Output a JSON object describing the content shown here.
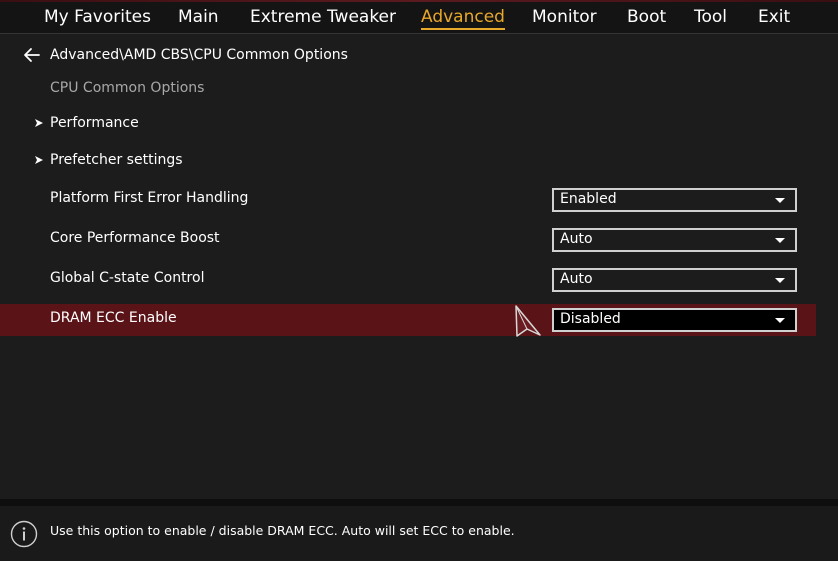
{
  "nav": {
    "tabs": [
      {
        "label": "My Favorites"
      },
      {
        "label": "Main"
      },
      {
        "label": "Extreme Tweaker"
      },
      {
        "label": "Advanced"
      },
      {
        "label": "Monitor"
      },
      {
        "label": "Boot"
      },
      {
        "label": "Tool"
      },
      {
        "label": "Exit"
      }
    ],
    "active_tab": "Advanced"
  },
  "breadcrumb": {
    "path": "Advanced\\AMD CBS\\CPU Common Options"
  },
  "section": {
    "title": "CPU Common Options"
  },
  "submenus": [
    {
      "label": "Performance"
    },
    {
      "label": "Prefetcher settings"
    }
  ],
  "options": [
    {
      "label": "Platform First Error Handling",
      "value": "Enabled"
    },
    {
      "label": "Core Performance Boost",
      "value": "Auto"
    },
    {
      "label": "Global C-state Control",
      "value": "Auto"
    },
    {
      "label": "DRAM ECC Enable",
      "value": "Disabled",
      "selected": true
    }
  ],
  "help": {
    "text": "Use this option to enable / disable DRAM ECC. Auto will set ECC to enable."
  },
  "colors": {
    "background": "#1c1c1c",
    "active_tab": "#e8a82a",
    "selected_row": "#5a1418"
  },
  "icons": [
    "back-arrow-icon",
    "chevron-right-icon",
    "dropdown-caret-icon",
    "mouse-cursor-icon",
    "info-icon"
  ]
}
